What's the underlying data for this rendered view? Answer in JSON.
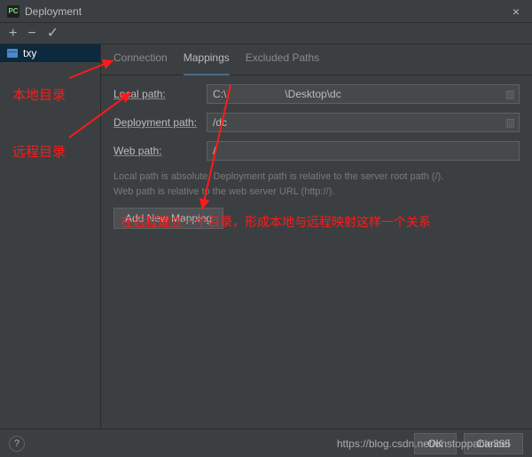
{
  "window": {
    "title": "Deployment"
  },
  "toolbar_tooltips": {
    "add": "+",
    "remove": "−",
    "check": "✓"
  },
  "sidebar": {
    "items": [
      {
        "label": "txy"
      }
    ]
  },
  "tabs": [
    {
      "label": "Connection",
      "active": false
    },
    {
      "label": "Mappings",
      "active": true
    },
    {
      "label": "Excluded Paths",
      "active": false
    }
  ],
  "form": {
    "local_path": {
      "label": "Local path:",
      "prefix": "C:\\",
      "visible_suffix": "\\Desktop\\dc"
    },
    "deployment_path": {
      "label": "Deployment path:",
      "value": "/dc"
    },
    "web_path": {
      "label": "Web path:",
      "value": "/"
    },
    "help_text": "Local path is absolute. Deployment path is relative to the server root path (/).\nWeb path is relative to the web server URL (http://).",
    "add_mapping_btn": "Add New Mapping"
  },
  "footer": {
    "help": "?",
    "ok": "OK",
    "cancel": "Cancel"
  },
  "watermark": "https://blog.csdn.net/unstoppable365",
  "annotations": {
    "local_dir": "本地目录",
    "remote_dir": "远程目录",
    "explain": "在远程建立一个目录，形成本地与远程映射这样一个关系"
  }
}
